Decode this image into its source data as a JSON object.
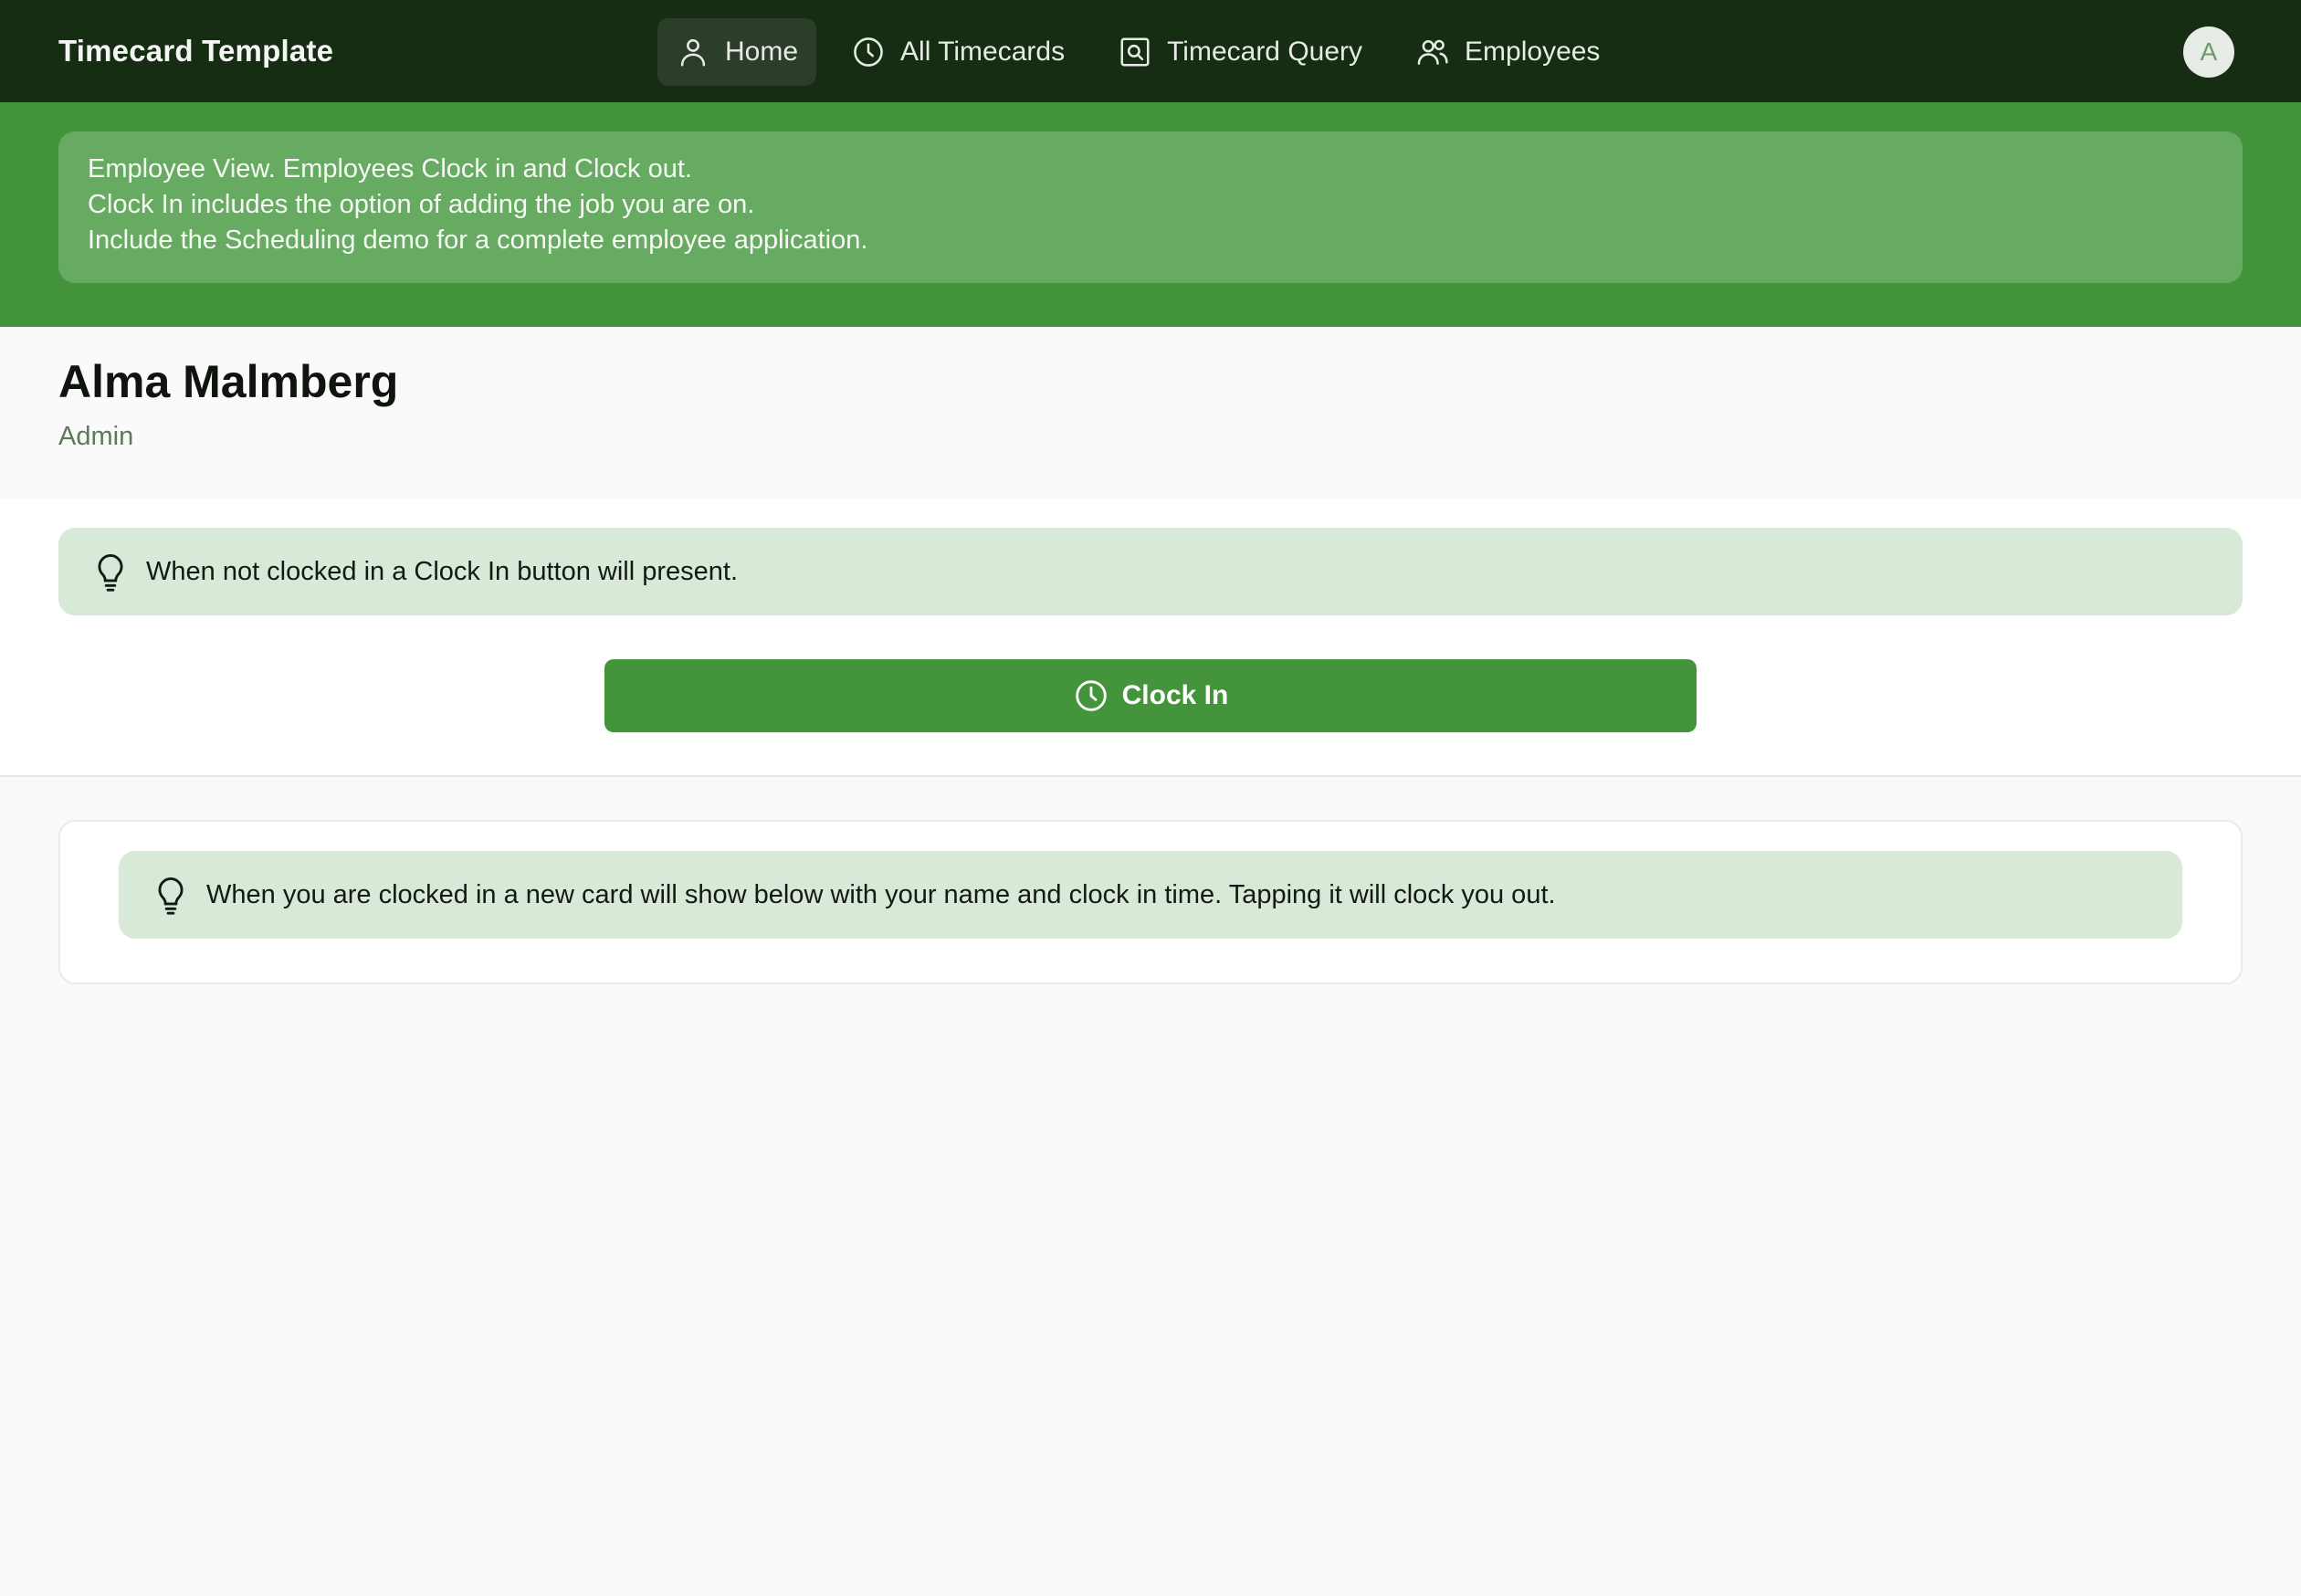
{
  "app": {
    "title": "Timecard Template"
  },
  "nav": {
    "items": [
      {
        "label": "Home",
        "icon": "user-icon",
        "active": true
      },
      {
        "label": "All Timecards",
        "icon": "clock-icon",
        "active": false
      },
      {
        "label": "Timecard Query",
        "icon": "search-square-icon",
        "active": false
      },
      {
        "label": "Employees",
        "icon": "users-icon",
        "active": false
      }
    ]
  },
  "user": {
    "avatar_initial": "A"
  },
  "hero": {
    "lines": [
      "Employee View. Employees Clock in and Clock out.",
      "Clock In includes the option of adding the job you are on.",
      "Include the Scheduling demo for a complete employee application."
    ]
  },
  "profile": {
    "name": "Alma Malmberg",
    "role": "Admin"
  },
  "clock": {
    "tip": "When not clocked in a Clock In button will present.",
    "button_label": "Clock In"
  },
  "card": {
    "tip": "When you are clocked in a new card will show below with your name and clock in time. Tapping it will clock you out."
  },
  "colors": {
    "nav_bg": "#172d13",
    "brand_green": "#43943a",
    "hero_box": "#67aa61",
    "tip_bg": "#d9e9d7",
    "page_bg": "#fafafa"
  }
}
